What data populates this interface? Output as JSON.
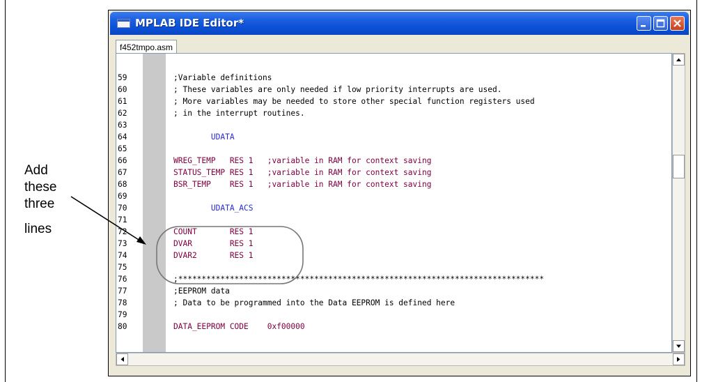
{
  "annotation": {
    "lines": [
      "Add",
      "these",
      "three",
      "lines"
    ]
  },
  "window": {
    "title": "MPLAB IDE Editor*"
  },
  "tab": {
    "label": "f452tmpo.asm"
  },
  "code_lines": [
    {
      "num": "59",
      "text": ";Variable definitions",
      "kind": "comment"
    },
    {
      "num": "60",
      "text": "; These variables are only needed if low priority interrupts are used.",
      "kind": "comment"
    },
    {
      "num": "61",
      "text": "; More variables may be needed to store other special function registers used",
      "kind": "comment"
    },
    {
      "num": "62",
      "text": "; in the interrupt routines.",
      "kind": "comment"
    },
    {
      "num": "63",
      "text": "",
      "kind": "text"
    },
    {
      "num": "64",
      "text": "        UDATA",
      "kind": "dir"
    },
    {
      "num": "65",
      "text": "",
      "kind": "text"
    },
    {
      "num": "66",
      "text": "WREG_TEMP   RES 1   ;variable in RAM for context saving",
      "kind": "label"
    },
    {
      "num": "67",
      "text": "STATUS_TEMP RES 1   ;variable in RAM for context saving",
      "kind": "label"
    },
    {
      "num": "68",
      "text": "BSR_TEMP    RES 1   ;variable in RAM for context saving",
      "kind": "label"
    },
    {
      "num": "69",
      "text": "",
      "kind": "text"
    },
    {
      "num": "70",
      "text": "        UDATA_ACS",
      "kind": "dir"
    },
    {
      "num": "71",
      "text": "",
      "kind": "text"
    },
    {
      "num": "72",
      "text": "COUNT       RES 1",
      "kind": "label"
    },
    {
      "num": "73",
      "text": "DVAR        RES 1",
      "kind": "label"
    },
    {
      "num": "74",
      "text": "DVAR2       RES 1",
      "kind": "label"
    },
    {
      "num": "75",
      "text": "",
      "kind": "text"
    },
    {
      "num": "76",
      "text": ";******************************************************************************",
      "kind": "comment"
    },
    {
      "num": "77",
      "text": ";EEPROM data",
      "kind": "comment"
    },
    {
      "num": "78",
      "text": "; Data to be programmed into the Data EEPROM is defined here",
      "kind": "comment"
    },
    {
      "num": "79",
      "text": "",
      "kind": "text"
    },
    {
      "num": "80",
      "text": "DATA_EEPROM CODE    0xf00000",
      "kind": "label"
    }
  ],
  "colors": {
    "titlebar": "#0a4fd6",
    "label": "#800040",
    "directive": "#2a2ad0",
    "gutter": "#c9c9c9"
  }
}
